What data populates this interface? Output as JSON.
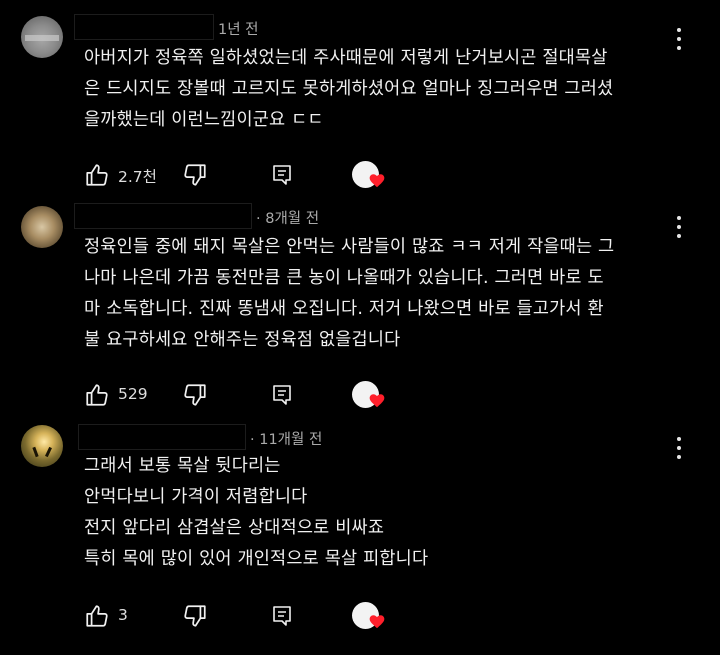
{
  "comments": [
    {
      "time": "1년 전",
      "lines": [
        "아버지가 정육쪽 일하셨었는데 주사때문에 저렇게 난거보시곤 절대목살",
        "은 드시지도 장볼때 고르지도 못하게하셨어요 얼마나 징그러우면 그러셨",
        "을까했는데 이런느낌이군요 ㄷㄷ"
      ],
      "likes": "2.7천"
    },
    {
      "time": "· 8개월 전",
      "lines": [
        "정육인들 중에 돼지 목살은 안먹는 사람들이 많죠 ㅋㅋ 저게 작을때는 그",
        "나마 나은데 가끔 동전만큼 큰 농이 나올때가 있습니다. 그러면 바로 도",
        "마 소독합니다. 진짜 똥냄새 오집니다. 저거 나왔으면 바로 들고가서 환",
        "불 요구하세요 안해주는 정육점 없을겁니다"
      ],
      "likes": "529"
    },
    {
      "time": "· 11개월 전",
      "lines": [
        "그래서 보통 목살 뒷다리는",
        "안먹다보니 가격이 저렴합니다",
        "전지 앞다리 삼겹살은 상대적으로 비싸죠",
        "특히 목에 많이 있어 개인적으로 목살 피합니다"
      ],
      "likes": "3"
    }
  ],
  "icons": {
    "like": "thumb-up-icon",
    "dislike": "thumb-down-icon",
    "reply": "comment-icon",
    "menu": "more-vert-icon",
    "heart": "heart-icon"
  },
  "colors": {
    "background": "#000000",
    "text": "#f1f1f1",
    "meta": "#aaaaaa",
    "heart": "#ff1f2b"
  }
}
